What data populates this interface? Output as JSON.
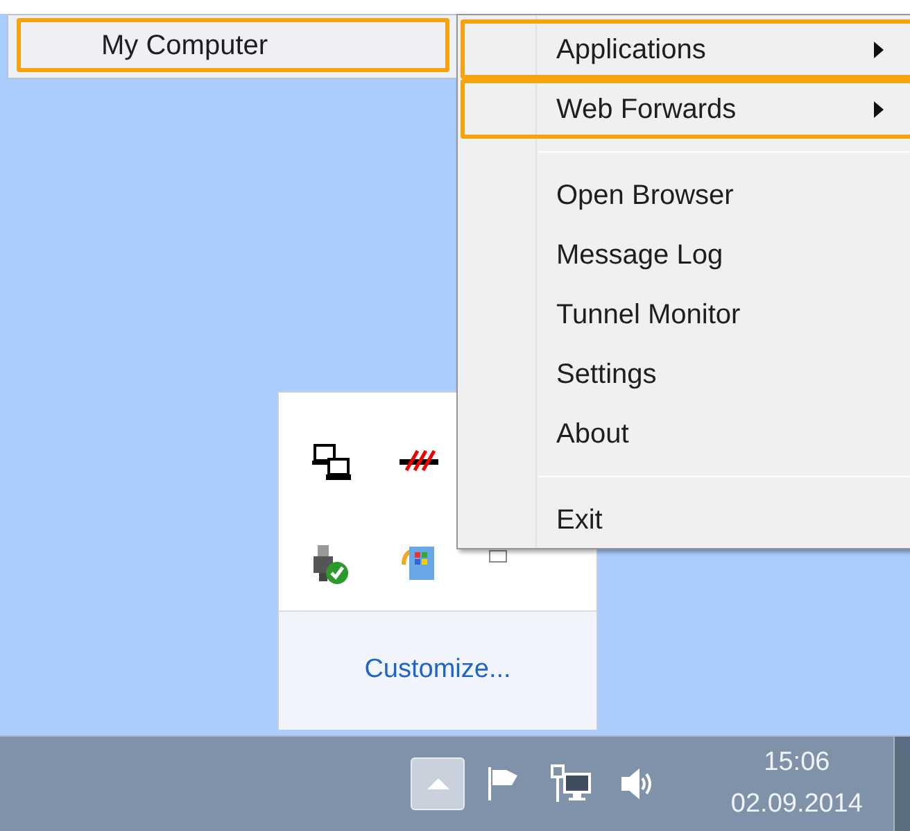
{
  "left_menu": {
    "items": [
      {
        "label": "My Computer",
        "highlighted": true,
        "has_submenu": false
      }
    ]
  },
  "context_menu": {
    "groups": [
      [
        {
          "label": "Applications",
          "highlighted": true,
          "has_submenu": true
        },
        {
          "label": "Web Forwards",
          "highlighted": true,
          "has_submenu": true
        }
      ],
      [
        {
          "label": "Open Browser",
          "highlighted": false,
          "has_submenu": false
        },
        {
          "label": "Message Log",
          "highlighted": false,
          "has_submenu": false
        },
        {
          "label": "Tunnel Monitor",
          "highlighted": false,
          "has_submenu": false
        },
        {
          "label": "Settings",
          "highlighted": false,
          "has_submenu": false
        },
        {
          "label": "About",
          "highlighted": false,
          "has_submenu": false
        }
      ],
      [
        {
          "label": "Exit",
          "highlighted": false,
          "has_submenu": false
        }
      ]
    ]
  },
  "tray_popup": {
    "link": "Customize..."
  },
  "taskbar": {
    "time": "15:06",
    "date": "02.09.2014"
  }
}
